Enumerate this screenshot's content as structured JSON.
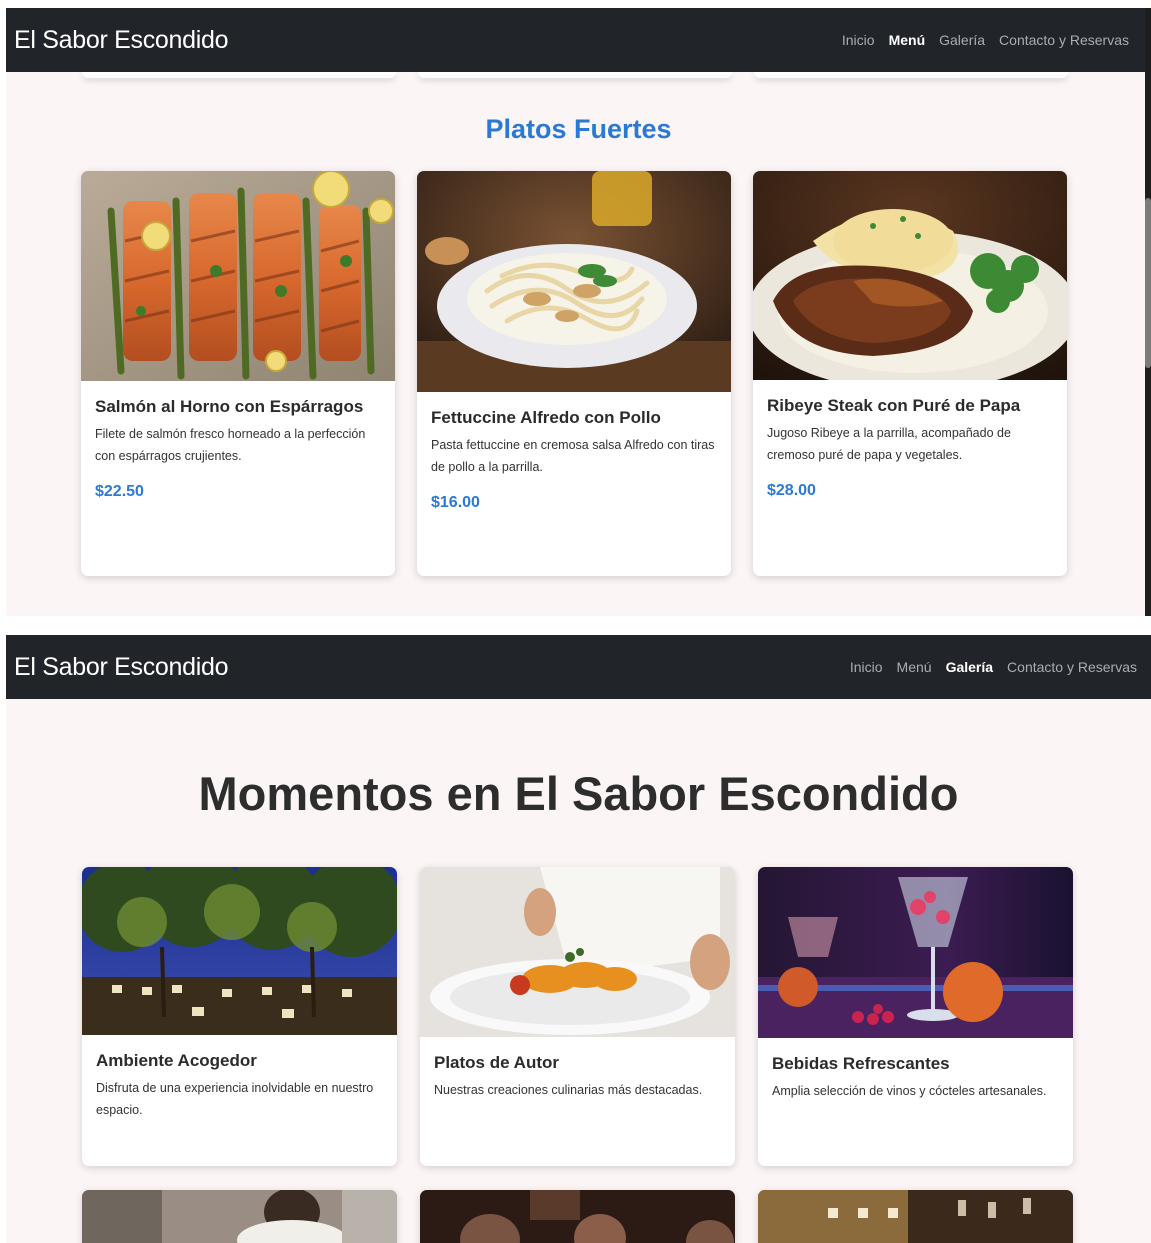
{
  "brand": "El Sabor Escondido",
  "nav": [
    "Inicio",
    "Menú",
    "Galería",
    "Contacto y Reservas"
  ],
  "menu_section": {
    "title": "Platos Fuertes",
    "dishes": [
      {
        "title": "Salmón al Horno con Espárragos",
        "description": "Filete de salmón fresco horneado a la perfección con espárragos crujientes.",
        "price": "$22.50"
      },
      {
        "title": "Fettuccine Alfredo con Pollo",
        "description": "Pasta fettuccine en cremosa salsa Alfredo con tiras de pollo a la parrilla.",
        "price": "$16.00"
      },
      {
        "title": "Ribeye Steak con Puré de Papa",
        "description": "Jugoso Ribeye a la parrilla, acompañado de cremoso puré de papa y vegetales.",
        "price": "$28.00"
      }
    ]
  },
  "gallery_section": {
    "title": "Momentos en El Sabor Escondido",
    "items": [
      {
        "title": "Ambiente Acogedor",
        "description": "Disfruta de una experiencia inolvidable en nuestro espacio."
      },
      {
        "title": "Platos de Autor",
        "description": "Nuestras creaciones culinarias más destacadas."
      },
      {
        "title": "Bebidas Refrescantes",
        "description": "Amplia selección de vinos y cócteles artesanales."
      }
    ]
  },
  "colors": {
    "navbar": "#212529",
    "accent": "#2a7ad4",
    "page_bg": "#fcf5f5"
  }
}
